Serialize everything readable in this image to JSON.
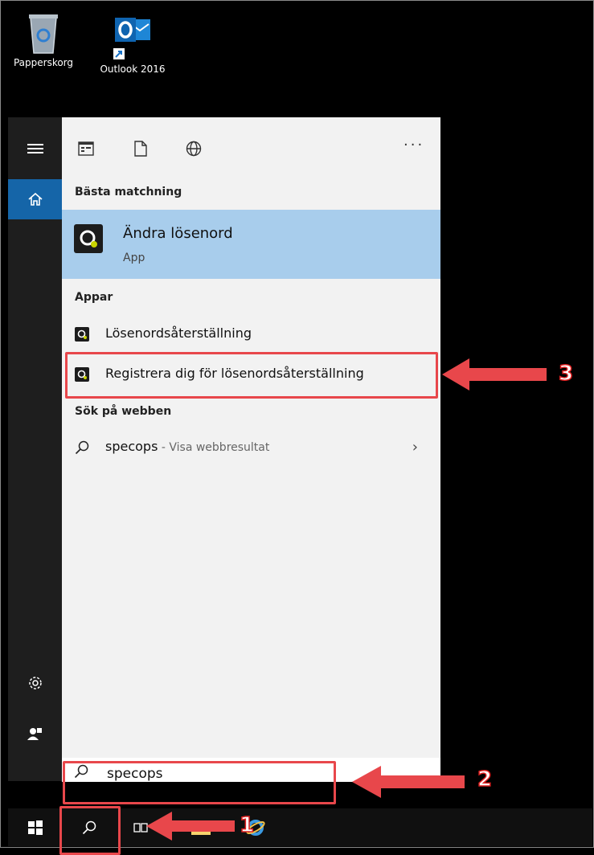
{
  "desktop": {
    "icons": [
      {
        "label": "Papperskorg",
        "icon": "recycle-bin-icon"
      },
      {
        "label": "Outlook 2016",
        "icon": "outlook-icon"
      }
    ]
  },
  "filter_bar": {
    "icons": [
      "apps-filter-icon",
      "documents-filter-icon",
      "web-filter-icon"
    ],
    "more": "···"
  },
  "results": {
    "best_match_header": "Bästa matchning",
    "best_match": {
      "title": "Ändra lösenord",
      "subtitle": "App"
    },
    "apps_header": "Appar",
    "apps": [
      {
        "label": "Lösenordsåterställning"
      },
      {
        "label": "Registrera dig för lösenordsåterställning"
      }
    ],
    "web_header": "Sök på webben",
    "web": {
      "query": "specops",
      "suffix": " - Visa webbresultat"
    }
  },
  "search": {
    "query": "specops"
  },
  "annotations": {
    "c1": "1",
    "c2": "2",
    "c3": "3"
  },
  "colors": {
    "highlight": "#a8cdec",
    "accent": "#1565a8",
    "annotation": "#e8474b"
  }
}
